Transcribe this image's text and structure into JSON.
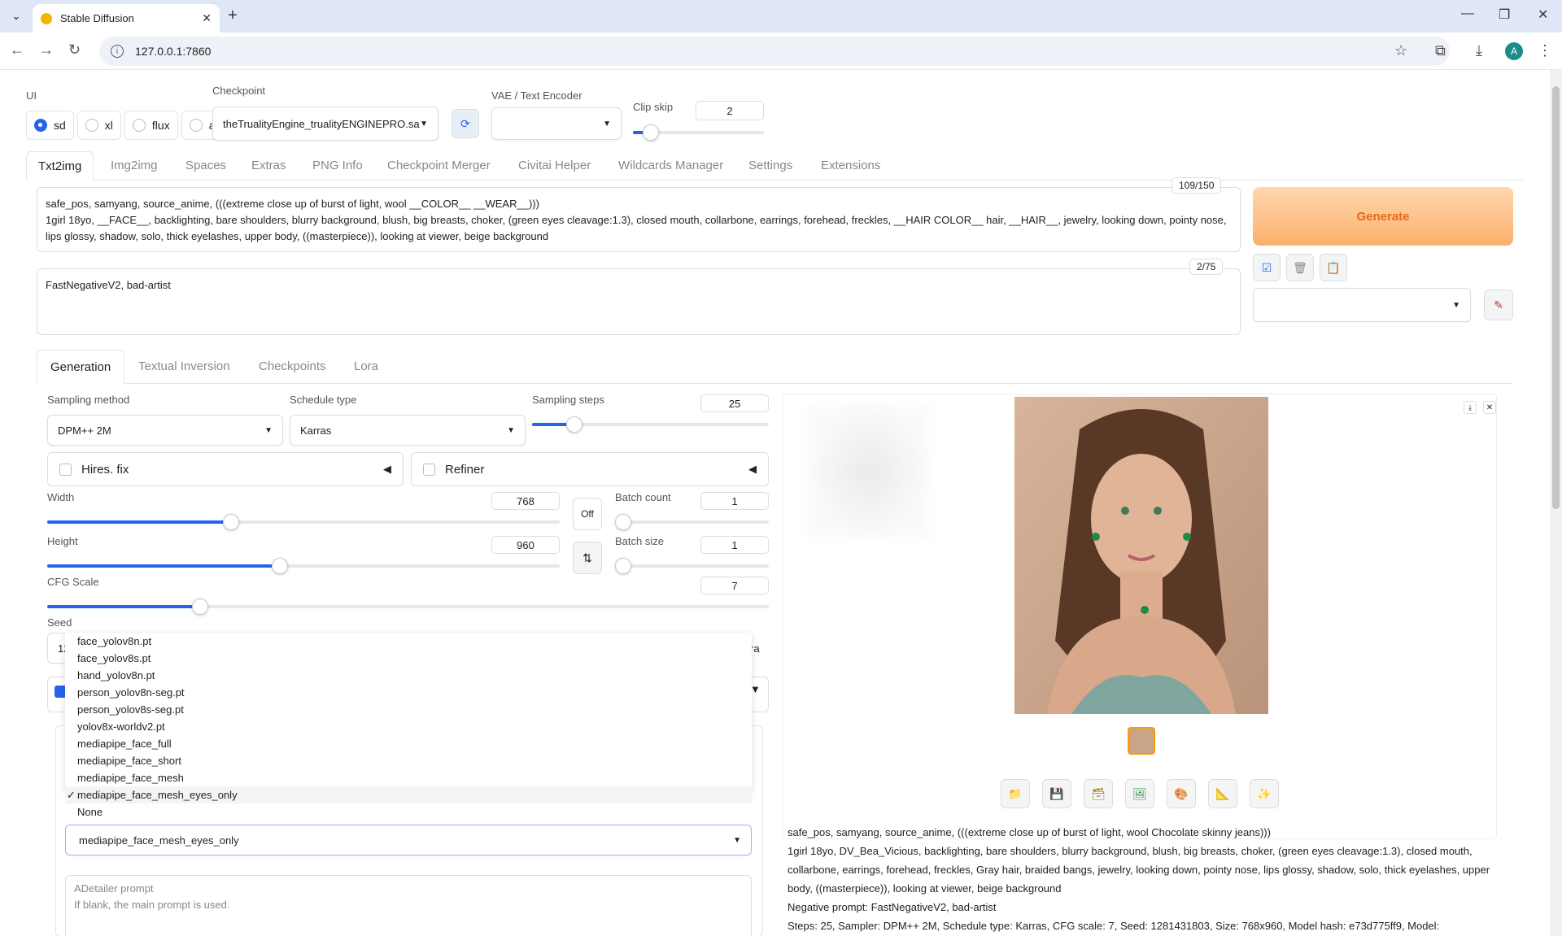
{
  "browser": {
    "tab_title": "Stable Diffusion",
    "url": "127.0.0.1:7860",
    "avatar_letter": "A"
  },
  "ui_selector": {
    "label": "UI",
    "options": [
      "sd",
      "xl",
      "flux",
      "all"
    ],
    "selected": "sd"
  },
  "checkpoint": {
    "label": "Checkpoint",
    "value": "theTrualityEngine_trualityENGINEPRO.sa"
  },
  "vae": {
    "label": "VAE / Text Encoder",
    "value": ""
  },
  "clip_skip": {
    "label": "Clip skip",
    "value": "2"
  },
  "main_tabs": [
    "Txt2img",
    "Img2img",
    "Spaces",
    "Extras",
    "PNG Info",
    "Checkpoint Merger",
    "Civitai Helper",
    "Wildcards Manager",
    "Settings",
    "Extensions"
  ],
  "prompt": {
    "counter": "109/150",
    "line1": "safe_pos, samyang, source_anime, (((extreme close up of burst of light, wool __COLOR__ __WEAR__)))",
    "line2": "1girl 18yo, __FACE__, backlighting, bare shoulders, blurry background, blush, big breasts, choker, (green eyes cleavage:1.3), closed mouth, collarbone, earrings, forehead, freckles, __HAIR COLOR__ hair, __HAIR__, jewelry, looking down, pointy nose,",
    "line3": "lips glossy, shadow, solo, thick eyelashes, upper body, ((masterpiece)), looking at viewer, beige background"
  },
  "negative_prompt": {
    "counter": "2/75",
    "text": "FastNegativeV2, bad-artist"
  },
  "generate_label": "Generate",
  "sub_tabs": [
    "Generation",
    "Textual Inversion",
    "Checkpoints",
    "Lora"
  ],
  "sampling": {
    "method_label": "Sampling method",
    "method": "DPM++ 2M",
    "schedule_label": "Schedule type",
    "schedule": "Karras",
    "steps_label": "Sampling steps",
    "steps": "25",
    "steps_fraction": 0.17
  },
  "hires_label": "Hires. fix",
  "refiner_label": "Refiner",
  "width": {
    "label": "Width",
    "value": "768",
    "fraction": 0.36
  },
  "height": {
    "label": "Height",
    "value": "960",
    "fraction": 0.46
  },
  "swap_label": "Off",
  "batch_count": {
    "label": "Batch count",
    "value": "1"
  },
  "batch_size": {
    "label": "Batch size",
    "value": "1"
  },
  "cfg": {
    "label": "CFG Scale",
    "value": "7",
    "fraction": 0.2
  },
  "seed": {
    "label": "Seed",
    "value_visible": "12",
    "extra_fragment": "ra"
  },
  "adetailer": {
    "dropdown_items": [
      "face_yolov8n.pt",
      "face_yolov8s.pt",
      "hand_yolov8n.pt",
      "person_yolov8n-seg.pt",
      "person_yolov8s-seg.pt",
      "yolov8x-worldv2.pt",
      "mediapipe_face_full",
      "mediapipe_face_short",
      "mediapipe_face_mesh",
      "mediapipe_face_mesh_eyes_only",
      "None"
    ],
    "selected_model": "mediapipe_face_mesh_eyes_only",
    "prompt_label": "ADetailer prompt",
    "prompt_placeholder": "If blank, the main prompt is used."
  },
  "output_info": {
    "line1": "safe_pos, samyang, source_anime, (((extreme close up of burst of light, wool Chocolate skinny jeans)))",
    "line2": "1girl 18yo, DV_Bea_Vicious, backlighting, bare shoulders, blurry background, blush, big breasts, choker, (green eyes cleavage:1.3), closed mouth,",
    "line3": "collarbone, earrings, forehead, freckles, Gray hair, braided bangs, jewelry, looking down, pointy nose, lips glossy, shadow, solo, thick eyelashes, upper",
    "line4": "body, ((masterpiece)), looking at viewer, beige background",
    "line5": "Negative prompt: FastNegativeV2, bad-artist",
    "line6": "Steps: 25, Sampler: DPM++ 2M, Schedule type: Karras, CFG scale: 7, Seed: 1281431803, Size: 768x960, Model hash: e73d775ff9, Model:"
  },
  "icons": {
    "refresh": "refresh-icon",
    "folder": "folder-icon",
    "save": "save-icon",
    "zip": "zip-icon",
    "img2img": "image-icon",
    "inpaint": "palette-icon",
    "extras": "ruler-icon",
    "sparkle": "sparkle-icon"
  },
  "colors": {
    "accent": "#2563eb",
    "generate_text": "#e8681a",
    "generate_bg": "#fbb06a"
  }
}
